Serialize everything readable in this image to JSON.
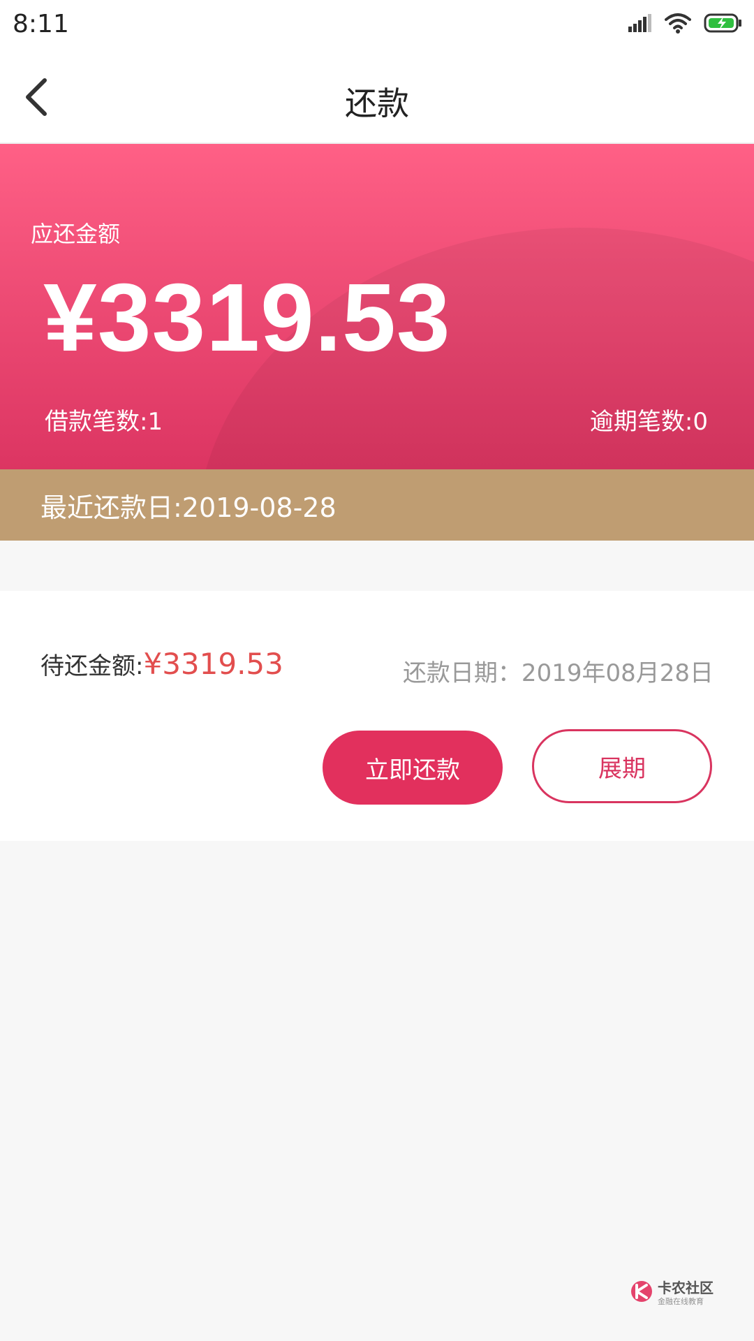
{
  "status_bar": {
    "time": "8:11",
    "icons": [
      "signal-icon",
      "wifi-icon",
      "battery-charging-icon"
    ]
  },
  "nav": {
    "title": "还款",
    "back_icon": "chevron-left-icon"
  },
  "hero": {
    "label": "应还金额",
    "amount": "¥3319.53",
    "loan_count": "借款笔数:1",
    "overdue_count": "逾期笔数:0"
  },
  "due_banner": {
    "text": "最近还款日:2019-08-28"
  },
  "card": {
    "pending_label": "待还金额:",
    "pending_amount": "¥3319.53",
    "repay_date": "还款日期：2019年08月28日",
    "repay_button": "立即还款",
    "extend_button": "展期"
  },
  "watermark": {
    "main": "卡农社区",
    "sub": "金融在线教育"
  },
  "colors": {
    "hero_top": "#ff6086",
    "hero_bottom": "#dc3562",
    "banner": "#bf9d72",
    "accent": "#e2305d",
    "amount_red": "#e24e4e"
  }
}
